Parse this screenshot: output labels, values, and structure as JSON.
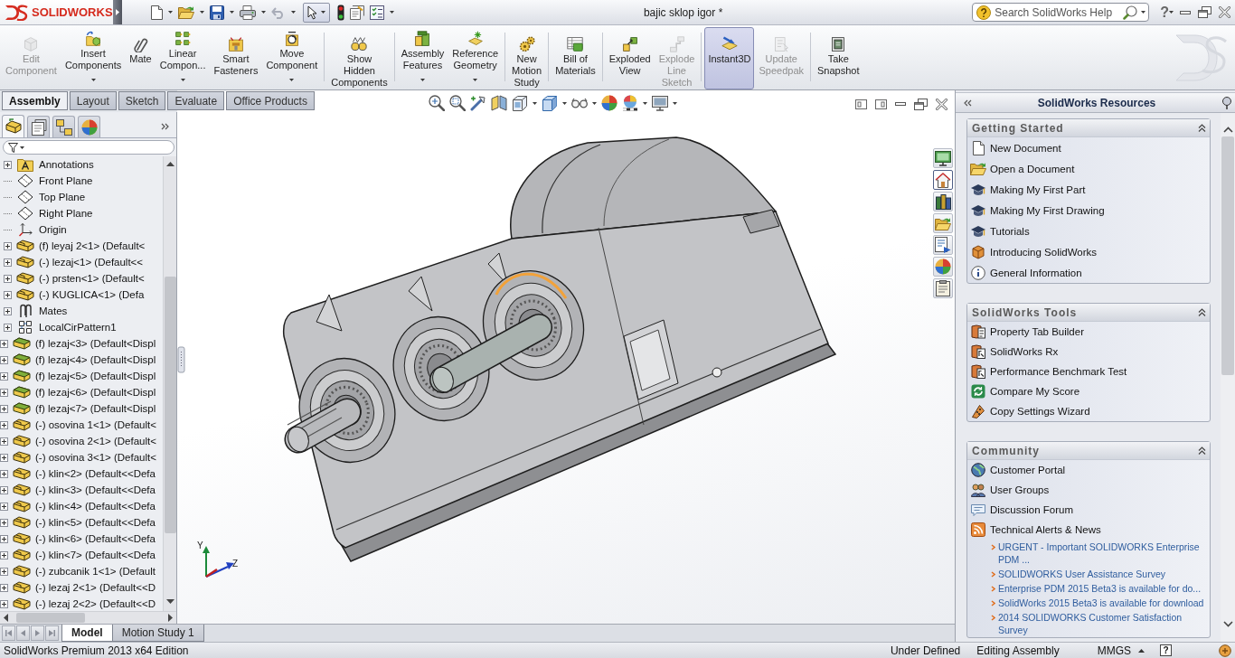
{
  "title_bar": {
    "logo": "SOLIDWORKS",
    "document_title": "bajic sklop igor *",
    "search": {
      "placeholder": "Search SolidWorks Help"
    },
    "help_glyph": "?"
  },
  "command_manager": {
    "groups": [
      {
        "buttons": [
          {
            "label": "Edit\nComponent",
            "disabled": true,
            "selected": false,
            "dropdown": false
          },
          {
            "label": "Insert\nComponents",
            "disabled": false,
            "selected": false,
            "dropdown": true
          },
          {
            "label": "Mate",
            "disabled": false,
            "selected": false,
            "dropdown": false
          },
          {
            "label": "Linear\nCompon...",
            "disabled": false,
            "selected": false,
            "dropdown": true
          },
          {
            "label": "Smart\nFasteners",
            "disabled": false,
            "selected": false,
            "dropdown": false
          },
          {
            "label": "Move\nComponent",
            "disabled": false,
            "selected": false,
            "dropdown": true
          }
        ]
      },
      {
        "buttons": [
          {
            "label": "Show\nHidden\nComponents",
            "disabled": false,
            "selected": false,
            "dropdown": false
          }
        ]
      },
      {
        "buttons": [
          {
            "label": "Assembly\nFeatures",
            "disabled": false,
            "selected": false,
            "dropdown": true
          },
          {
            "label": "Reference\nGeometry",
            "disabled": false,
            "selected": false,
            "dropdown": true
          }
        ]
      },
      {
        "buttons": [
          {
            "label": "New\nMotion\nStudy",
            "disabled": false,
            "selected": false,
            "dropdown": false
          }
        ]
      },
      {
        "buttons": [
          {
            "label": "Bill of\nMaterials",
            "disabled": false,
            "selected": false,
            "dropdown": false
          }
        ]
      },
      {
        "buttons": [
          {
            "label": "Exploded\nView",
            "disabled": false,
            "selected": false,
            "dropdown": false
          },
          {
            "label": "Explode\nLine\nSketch",
            "disabled": true,
            "selected": false,
            "dropdown": false
          }
        ]
      },
      {
        "buttons": [
          {
            "label": "Instant3D",
            "disabled": false,
            "selected": true,
            "dropdown": false
          },
          {
            "label": "Update\nSpeedpak",
            "disabled": true,
            "selected": false,
            "dropdown": false
          }
        ]
      },
      {
        "buttons": [
          {
            "label": "Take\nSnapshot",
            "disabled": false,
            "selected": false,
            "dropdown": false
          }
        ]
      }
    ],
    "tabs": [
      {
        "label": "Assembly",
        "selected": true
      },
      {
        "label": "Layout",
        "selected": false
      },
      {
        "label": "Sketch",
        "selected": false
      },
      {
        "label": "Evaluate",
        "selected": false
      },
      {
        "label": "Office Products",
        "selected": false
      }
    ]
  },
  "feature_manager": {
    "panel_tabs": [
      {
        "selected": true
      },
      {
        "selected": false
      },
      {
        "selected": false
      },
      {
        "selected": false
      }
    ],
    "tree": {
      "items": [
        {
          "children": [
            {
              "label": "Annotations",
              "kind": "annotations",
              "expanded": false
            },
            {
              "label": "Front Plane",
              "kind": "plane"
            },
            {
              "label": "Top Plane",
              "kind": "plane"
            },
            {
              "label": "Right Plane",
              "kind": "plane"
            },
            {
              "label": "Origin",
              "kind": "origin"
            },
            {
              "label": "(f) leyaj 2<1> (Default<",
              "kind": "part",
              "expanded": false
            },
            {
              "label": "(-) lezaj<1> (Default<<",
              "kind": "part",
              "expanded": false
            },
            {
              "label": "(-) prsten<1> (Default<",
              "kind": "part",
              "expanded": false
            },
            {
              "label": "(-) KUGLICA<1> (Defa",
              "kind": "part",
              "expanded": false
            },
            {
              "label": "Mates",
              "kind": "mates",
              "expanded": false
            },
            {
              "label": "LocalCirPattern1",
              "kind": "pattern",
              "expanded": false
            }
          ]
        },
        {
          "label": "(f) lezaj<3> (Default<Displ",
          "kind": "assembly",
          "expanded": false
        },
        {
          "label": "(f) lezaj<4> (Default<Displ",
          "kind": "assembly",
          "expanded": false
        },
        {
          "label": "(f) lezaj<5> (Default<Displ",
          "kind": "assembly",
          "expanded": false
        },
        {
          "label": "(f) lezaj<6> (Default<Displ",
          "kind": "assembly",
          "expanded": false
        },
        {
          "label": "(f) lezaj<7> (Default<Displ",
          "kind": "assembly",
          "expanded": false
        },
        {
          "label": "(-) osovina 1<1> (Default<",
          "kind": "part",
          "expanded": false
        },
        {
          "label": "(-) osovina 2<1> (Default<",
          "kind": "part",
          "expanded": false
        },
        {
          "label": "(-) osovina 3<1> (Default<",
          "kind": "part",
          "expanded": false
        },
        {
          "label": "(-) klin<2> (Default<<Defa",
          "kind": "part",
          "expanded": false
        },
        {
          "label": "(-) klin<3> (Default<<Defa",
          "kind": "part",
          "expanded": false
        },
        {
          "label": "(-) klin<4> (Default<<Defa",
          "kind": "part",
          "expanded": false
        },
        {
          "label": "(-) klin<5> (Default<<Defa",
          "kind": "part",
          "expanded": false
        },
        {
          "label": "(-) klin<6> (Default<<Defa",
          "kind": "part",
          "expanded": false
        },
        {
          "label": "(-) klin<7> (Default<<Defa",
          "kind": "part",
          "expanded": false
        },
        {
          "label": "(-) zubcanik 1<1> (Default",
          "kind": "part",
          "expanded": false
        },
        {
          "label": "(-) lezaj 2<1> (Default<<D",
          "kind": "part",
          "expanded": false
        },
        {
          "label": "(-) lezaj 2<2> (Default<<D",
          "kind": "part",
          "expanded": false
        }
      ]
    }
  },
  "graphics_area": {
    "triad_labels": [
      "Y",
      "Z"
    ],
    "task_pane_tabs": [
      {
        "selected": false
      },
      {
        "selected": true
      },
      {
        "selected": false
      },
      {
        "selected": false
      },
      {
        "selected": false
      },
      {
        "selected": false
      },
      {
        "selected": false
      }
    ]
  },
  "task_pane": {
    "title": "SolidWorks Resources",
    "sections": [
      {
        "title": "Getting Started",
        "expanded": true,
        "items": [
          "New Document",
          "Open a Document",
          "Making My First Part",
          "Making My First Drawing",
          "Tutorials",
          "Introducing SolidWorks",
          "General Information"
        ]
      },
      {
        "title": "SolidWorks Tools",
        "expanded": true,
        "items": [
          "Property Tab Builder",
          "SolidWorks Rx",
          "Performance Benchmark Test",
          "Compare My Score",
          "Copy Settings Wizard"
        ]
      },
      {
        "title": "Community",
        "expanded": true,
        "items": [
          "Customer Portal",
          "User Groups",
          "Discussion Forum",
          "Technical Alerts & News"
        ],
        "news": [
          "URGENT - Important SOLIDWORKS Enterprise PDM ...",
          "SOLIDWORKS User Assistance Survey",
          "Enterprise PDM 2015 Beta3 is available for do...",
          "SolidWorks 2015 Beta3 is available for download",
          "2014 SOLIDWORKS Customer Satisfaction Survey"
        ]
      }
    ]
  },
  "bottom_tabs": [
    {
      "label": "Model",
      "selected": true
    },
    {
      "label": "Motion Study 1",
      "selected": false
    }
  ],
  "status_bar": {
    "edition": "SolidWorks Premium 2013 x64 Edition",
    "sketch_state": "Under Defined",
    "mode": "Editing Assembly",
    "units": "MMGS",
    "help_glyph": "?"
  }
}
